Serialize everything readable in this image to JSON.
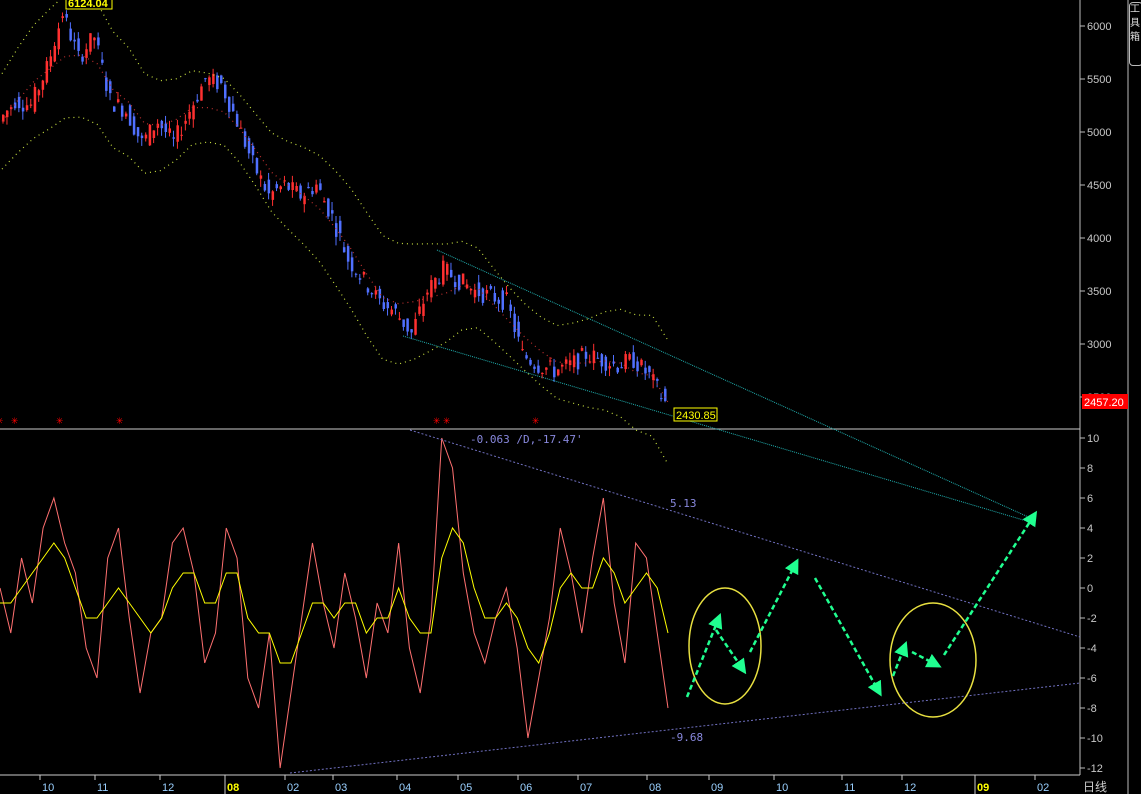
{
  "price_panel": {
    "high_label": "6124.04",
    "low_label": "2430.85",
    "current_price": "2457.20",
    "current_price_color": "#ff0000",
    "y_ticks": [
      "6000",
      "5500",
      "5000",
      "4500",
      "4000",
      "3500",
      "3000",
      "2500"
    ],
    "candle_up_color": "#ff3030",
    "candle_down_color": "#5070ff",
    "trendline_color": "#20b0b0",
    "closes": [
      5100,
      5300,
      5250,
      5600,
      6124,
      5700,
      5900,
      5300,
      5200,
      4900,
      5100,
      4900,
      5200,
      5500,
      5450,
      5100,
      4700,
      4400,
      4500,
      4400,
      4500,
      4200,
      3800,
      3600,
      3400,
      3300,
      3100,
      3500,
      3700,
      3600,
      3500,
      3450,
      3400,
      2900,
      2800,
      2750,
      2800,
      2900,
      2850,
      2800,
      2850,
      2700,
      2450
    ],
    "signal_marker": "✳"
  },
  "oscillator_panel": {
    "header": "-0.063 /D,-17.47'",
    "upper_line_label": "5.13",
    "lower_line_label": "-9.68",
    "y_ticks": [
      "10",
      "8",
      "6",
      "4",
      "2",
      "0",
      "-2",
      "-4",
      "-6",
      "-8",
      "-10",
      "-12"
    ],
    "line_color": "#ff7070",
    "signal_color": "#ffff00",
    "values": [
      0,
      -3,
      2,
      -1,
      4,
      6,
      3,
      1,
      -4,
      -6,
      2,
      4,
      -2,
      -7,
      -3,
      -2,
      3,
      4,
      1,
      -5,
      -3,
      4,
      2,
      -6,
      -8,
      -3,
      -12,
      -7,
      -2,
      3,
      -1,
      -4,
      1,
      -2,
      -6,
      -1,
      -3,
      3,
      -4,
      -7,
      -2,
      10,
      8,
      1,
      -3,
      -5,
      -2,
      0,
      -4,
      -10,
      -6,
      -2,
      4,
      1,
      -3,
      2,
      6,
      -1,
      -5,
      3,
      2,
      -3,
      -8
    ],
    "signal": [
      -1,
      -1,
      0,
      1,
      2,
      3,
      2,
      0,
      -2,
      -2,
      -1,
      0,
      -1,
      -2,
      -3,
      -2,
      0,
      1,
      1,
      -1,
      -1,
      1,
      1,
      -2,
      -3,
      -3,
      -5,
      -5,
      -3,
      -1,
      -1,
      -2,
      -1,
      -1,
      -3,
      -2,
      -2,
      0,
      -2,
      -3,
      -3,
      2,
      4,
      3,
      0,
      -2,
      -2,
      -1,
      -2,
      -4,
      -5,
      -3,
      0,
      1,
      0,
      0,
      2,
      1,
      -1,
      0,
      1,
      0,
      -3
    ]
  },
  "time_axis": {
    "labels": [
      "10",
      "11",
      "12",
      "08",
      "02",
      "03",
      "04",
      "05",
      "06",
      "07",
      "08",
      "09",
      "10",
      "11",
      "12",
      "09",
      "02"
    ],
    "year_labels": [
      "08",
      "09"
    ],
    "period_label": "日线"
  },
  "toolbox": {
    "label": "工具箱"
  }
}
